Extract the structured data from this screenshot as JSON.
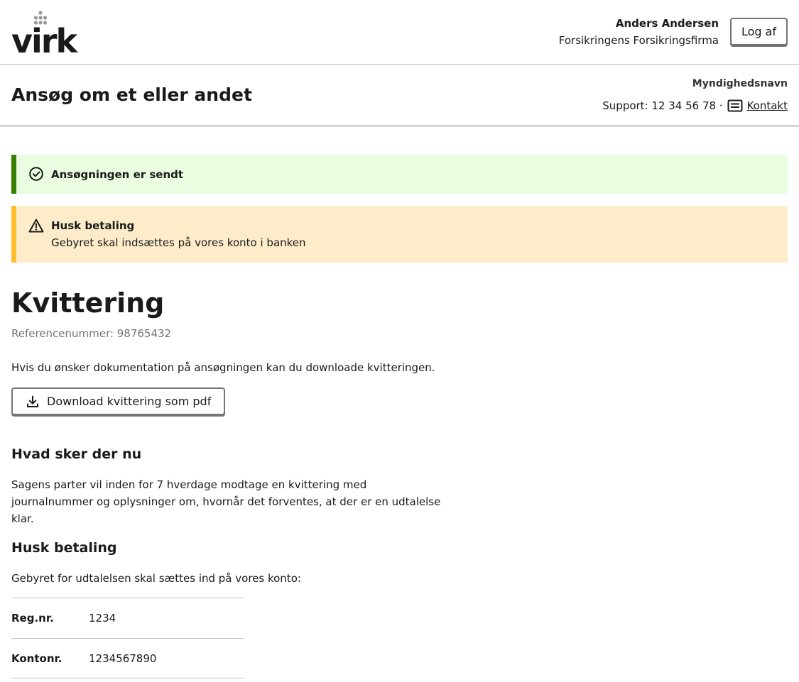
{
  "header": {
    "logo_text": "virk",
    "user_name": "Anders Andersen",
    "user_org": "Forsikringens Forsikringsfirma",
    "logout_label": "Log af"
  },
  "service": {
    "title": "Ansøg om et eller andet",
    "authority_name": "Myndighedsnavn",
    "support_text": "Support: 12 34 56 78 ·",
    "contact_icon": "contact-card-icon",
    "contact_label": "Kontakt"
  },
  "alerts": {
    "success": {
      "icon": "check-circle-icon",
      "heading": "Ansøgningen er sendt",
      "color": "#358000",
      "background": "#ebfde0"
    },
    "warning": {
      "icon": "warning-triangle-icon",
      "heading": "Husk betaling",
      "text": "Gebyret skal indsættes på vores konto i banken",
      "color": "#ffbc2c",
      "background": "#fdecc9"
    }
  },
  "main": {
    "heading": "Kvittering",
    "reference": "Referencenummer: 98765432",
    "intro": "Hvis du ønsker dokumentation på ansøgningen kan du downloade kvitteringen.",
    "download_icon": "download-icon",
    "download_label": "Download kvittering som pdf",
    "next_heading": "Hvad sker der nu",
    "next_text": "Sagens parter vil inden for 7 hverdage modtage en kvittering med journalnummer og oplysninger om, hvornår det forventes, at der er en udtalelse klar.",
    "payment_heading": "Husk betaling",
    "payment_text": "Gebyret for udtalelsen skal sættes ind på vores konto:",
    "account_rows": [
      {
        "label": "Reg.nr.",
        "value": "1234"
      },
      {
        "label": "Kontonr.",
        "value": "1234567890"
      }
    ]
  }
}
